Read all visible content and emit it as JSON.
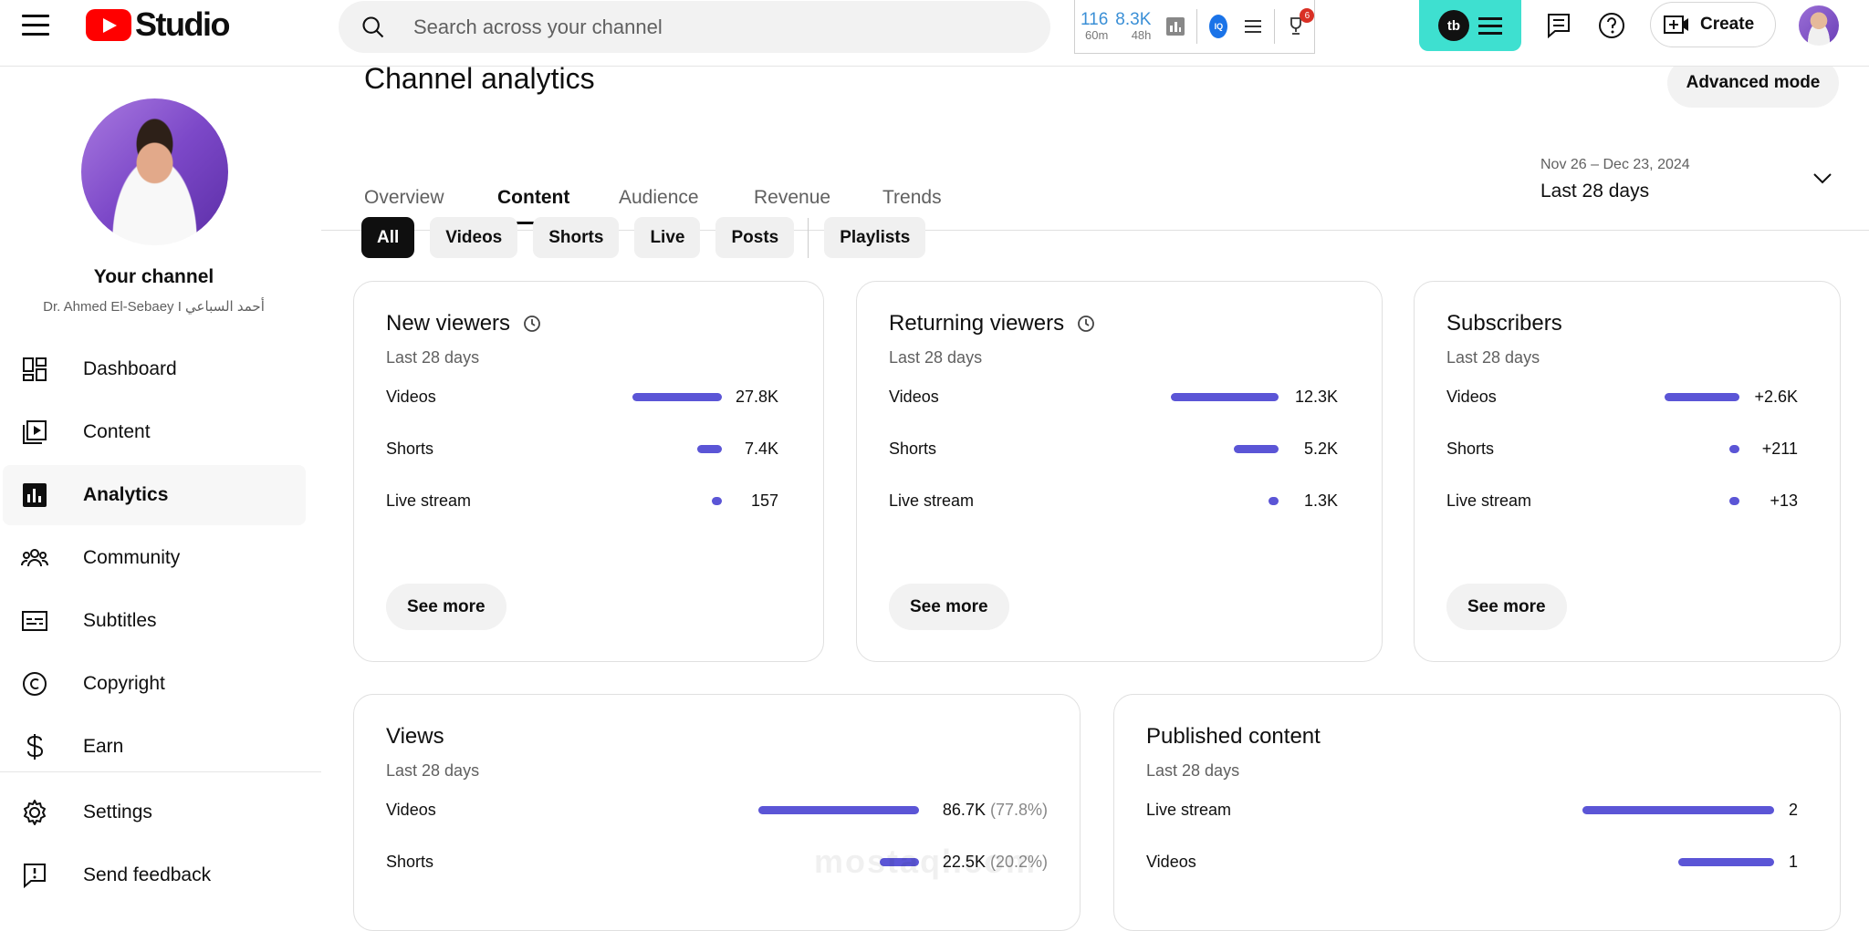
{
  "header": {
    "logo_text": "Studio",
    "search_placeholder": "Search across your channel",
    "ext_stat1_value": "116",
    "ext_stat1_sub": "60m",
    "ext_stat2_value": "8.3K",
    "ext_stat2_sub": "48h",
    "iq_label": "IQ",
    "trophy_badge": "6",
    "tb_label": "tb",
    "create_label": "Create"
  },
  "sidebar": {
    "your_channel": "Your channel",
    "channel_name": "Dr. Ahmed El-Sebaey I أحمد السباعي",
    "items": [
      {
        "label": "Dashboard"
      },
      {
        "label": "Content"
      },
      {
        "label": "Analytics"
      },
      {
        "label": "Community"
      },
      {
        "label": "Subtitles"
      },
      {
        "label": "Copyright"
      },
      {
        "label": "Earn"
      },
      {
        "label": "Settings"
      },
      {
        "label": "Send feedback"
      }
    ]
  },
  "main": {
    "title": "Channel analytics",
    "advanced_mode": "Advanced mode",
    "tabs": [
      "Overview",
      "Content",
      "Audience",
      "Revenue",
      "Trends"
    ],
    "date_range": "Nov 26 – Dec 23, 2024",
    "period": "Last 28 days",
    "chips": [
      "All",
      "Videos",
      "Shorts",
      "Live",
      "Posts",
      "Playlists"
    ]
  },
  "cards": {
    "new_viewers": {
      "title": "New viewers",
      "sub": "Last 28 days",
      "see_more": "See more",
      "rows": [
        {
          "label": "Videos",
          "value": "27.8K"
        },
        {
          "label": "Shorts",
          "value": "7.4K"
        },
        {
          "label": "Live stream",
          "value": "157"
        }
      ]
    },
    "returning_viewers": {
      "title": "Returning viewers",
      "sub": "Last 28 days",
      "see_more": "See more",
      "rows": [
        {
          "label": "Videos",
          "value": "12.3K"
        },
        {
          "label": "Shorts",
          "value": "5.2K"
        },
        {
          "label": "Live stream",
          "value": "1.3K"
        }
      ]
    },
    "subscribers": {
      "title": "Subscribers",
      "sub": "Last 28 days",
      "see_more": "See more",
      "rows": [
        {
          "label": "Videos",
          "value": "+2.6K"
        },
        {
          "label": "Shorts",
          "value": "+211"
        },
        {
          "label": "Live stream",
          "value": "+13"
        }
      ]
    },
    "views": {
      "title": "Views",
      "sub": "Last 28 days",
      "rows": [
        {
          "label": "Videos",
          "value": "86.7K",
          "pct": "(77.8%)"
        },
        {
          "label": "Shorts",
          "value": "22.5K",
          "pct": "(20.2%)"
        }
      ]
    },
    "published": {
      "title": "Published content",
      "sub": "Last 28 days",
      "rows": [
        {
          "label": "Live stream",
          "value": "2"
        },
        {
          "label": "Videos",
          "value": "1"
        }
      ]
    }
  },
  "watermark": "mostaql.com",
  "colors": {
    "accent_bar": "#5b55d6",
    "brand_red": "#ff0000",
    "ext_teal": "#3ee0d0"
  }
}
